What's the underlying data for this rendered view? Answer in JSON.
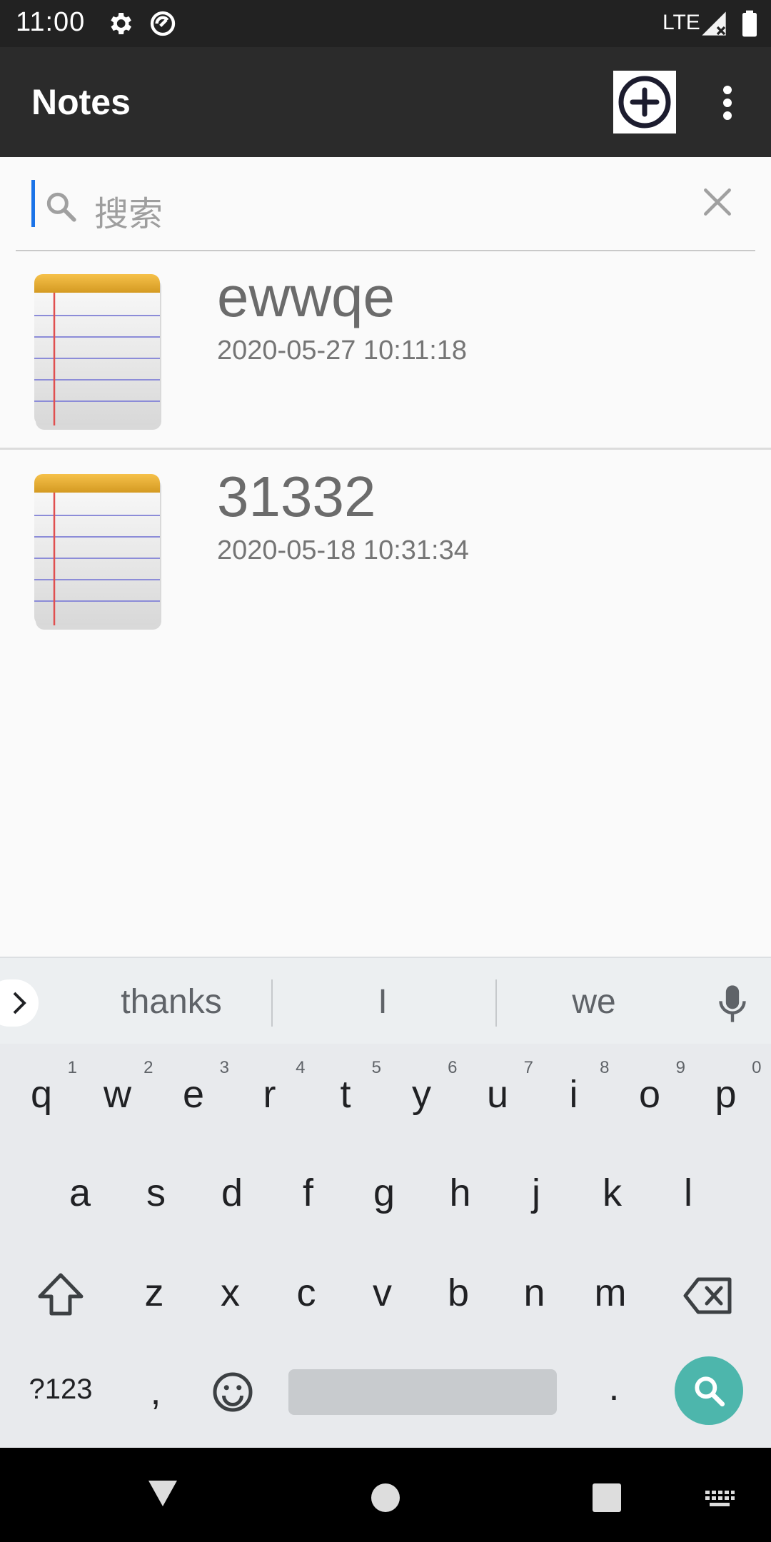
{
  "status_bar": {
    "time": "11:00",
    "network": "LTE"
  },
  "app_bar": {
    "title": "Notes",
    "icons": [
      "add-circle-icon",
      "more-vert-icon"
    ]
  },
  "search": {
    "placeholder": "搜索",
    "value": ""
  },
  "notes": [
    {
      "title": "ewwqe",
      "date": "2020-05-27 10:11:18"
    },
    {
      "title": "31332",
      "date": "2020-05-18 10:31:34"
    }
  ],
  "keyboard": {
    "suggestions": [
      "thanks",
      "I",
      "we"
    ],
    "row1": [
      "q",
      "w",
      "e",
      "r",
      "t",
      "y",
      "u",
      "i",
      "o",
      "p"
    ],
    "row1_hints": [
      "1",
      "2",
      "3",
      "4",
      "5",
      "6",
      "7",
      "8",
      "9",
      "0"
    ],
    "row2": [
      "a",
      "s",
      "d",
      "f",
      "g",
      "h",
      "j",
      "k",
      "l"
    ],
    "row3": [
      "z",
      "x",
      "c",
      "v",
      "b",
      "n",
      "m"
    ],
    "symbols_label": "?123",
    "comma": ",",
    "period": "."
  },
  "colors": {
    "appbar": "#2b2b2b",
    "statusbar": "#222222",
    "cursor": "#1a73e8",
    "search_key": "#4db6ac"
  }
}
